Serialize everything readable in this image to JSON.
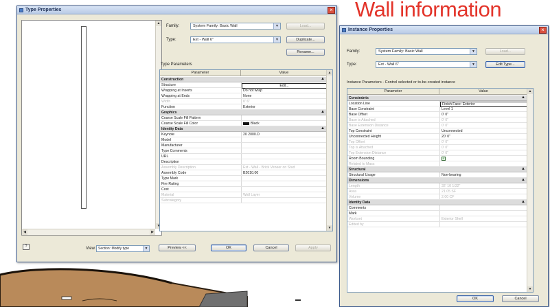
{
  "heading": "Wall information",
  "type_properties": {
    "title": "Type Properties",
    "family_label": "Family:",
    "family_value": "System Family: Basic Wall",
    "load_button": "Load...",
    "type_label": "Type:",
    "type_value": "Ext - Wall 6\"",
    "duplicate_button": "Duplicate...",
    "rename_button": "Rename...",
    "section_label": "Type Parameters",
    "col_parameter": "Parameter",
    "col_value": "Value",
    "rows": [
      {
        "kind": "group",
        "name": "Construction"
      },
      {
        "kind": "selected",
        "name": "Structure",
        "value": "Edit..."
      },
      {
        "kind": "row",
        "name": "Wrapping at Inserts",
        "value": "Do not wrap"
      },
      {
        "kind": "row",
        "name": "Wrapping at Ends",
        "value": "None"
      },
      {
        "kind": "disabled",
        "name": "Width",
        "value": "0' 6\""
      },
      {
        "kind": "row",
        "name": "Function",
        "value": "Exterior"
      },
      {
        "kind": "group",
        "name": "Graphics"
      },
      {
        "kind": "row",
        "name": "Coarse Scale Fill Pattern",
        "value": ""
      },
      {
        "kind": "swatch",
        "name": "Coarse Scale Fill Color",
        "value": "Black"
      },
      {
        "kind": "group",
        "name": "Identity Data"
      },
      {
        "kind": "row",
        "name": "Keynote",
        "value": "20 2000.D"
      },
      {
        "kind": "row",
        "name": "Model",
        "value": ""
      },
      {
        "kind": "row",
        "name": "Manufacturer",
        "value": ""
      },
      {
        "kind": "row",
        "name": "Type Comments",
        "value": ""
      },
      {
        "kind": "row",
        "name": "URL",
        "value": ""
      },
      {
        "kind": "row",
        "name": "Description",
        "value": ""
      },
      {
        "kind": "disabled",
        "name": "Assembly Description",
        "value": "Ext - Wall - Brick Veneer on Stud"
      },
      {
        "kind": "row",
        "name": "Assembly Code",
        "value": "B2010.00"
      },
      {
        "kind": "row",
        "name": "Type Mark",
        "value": ""
      },
      {
        "kind": "row",
        "name": "Fire Rating",
        "value": ""
      },
      {
        "kind": "row",
        "name": "Cost",
        "value": ""
      },
      {
        "kind": "disabled",
        "name": "Material",
        "value": "Wall Layer"
      },
      {
        "kind": "disabled",
        "name": "Subcategory",
        "value": ""
      }
    ],
    "view_label": "View:",
    "view_value": "Section: Modify type",
    "preview_button": "Preview <<",
    "ok_button": "OK",
    "cancel_button": "Cancel",
    "apply_button": "Apply"
  },
  "instance_properties": {
    "title": "Instance Properties",
    "family_label": "Family:",
    "family_value": "System Family: Basic Wall",
    "load_button": "Load...",
    "type_label": "Type:",
    "type_value": "Ext - Wall 6\"",
    "edit_type_button": "Edit Type...",
    "section_label": "Instance Parameters - Control selected or to-be-created instance",
    "col_parameter": "Parameter",
    "col_value": "Value",
    "rows": [
      {
        "kind": "group",
        "name": "Constraints"
      },
      {
        "kind": "selected",
        "name": "Location Line",
        "value": "Finish Face: Exterior"
      },
      {
        "kind": "row",
        "name": "Base Constraint",
        "value": "Level 1"
      },
      {
        "kind": "row",
        "name": "Base Offset",
        "value": "0' 0\""
      },
      {
        "kind": "disabled",
        "name": "Base is Attached",
        "value": "0' 0\""
      },
      {
        "kind": "disabled",
        "name": "Base Extension Distance",
        "value": "0' 0\""
      },
      {
        "kind": "row",
        "name": "Top Constraint",
        "value": "Unconnected"
      },
      {
        "kind": "row",
        "name": "Unconnected Height",
        "value": "20' 0\""
      },
      {
        "kind": "disabled",
        "name": "Top Offset",
        "value": "0' 0\""
      },
      {
        "kind": "disabled",
        "name": "Top is Attached",
        "value": "0' 0\""
      },
      {
        "kind": "disabled",
        "name": "Top Extension Distance",
        "value": "0' 0\""
      },
      {
        "kind": "check",
        "name": "Room Bounding",
        "value": ""
      },
      {
        "kind": "disabled",
        "name": "Related to Mass",
        "value": ""
      },
      {
        "kind": "group",
        "name": "Structural"
      },
      {
        "kind": "row",
        "name": "Structural Usage",
        "value": "Non-bearing"
      },
      {
        "kind": "group",
        "name": "Dimensions"
      },
      {
        "kind": "disabled",
        "name": "Length",
        "value": "32' 10 1/32\""
      },
      {
        "kind": "disabled",
        "name": "Area",
        "value": "21.05 SF"
      },
      {
        "kind": "disabled",
        "name": "Volume",
        "value": "2.00 CF"
      },
      {
        "kind": "group",
        "name": "Identity Data"
      },
      {
        "kind": "row",
        "name": "Comments",
        "value": ""
      },
      {
        "kind": "row",
        "name": "Mark",
        "value": ""
      },
      {
        "kind": "disabled",
        "name": "Workset",
        "value": "Exterior Shell"
      },
      {
        "kind": "disabled",
        "name": "Edited by",
        "value": ""
      }
    ],
    "ok_button": "OK",
    "cancel_button": "Cancel"
  }
}
